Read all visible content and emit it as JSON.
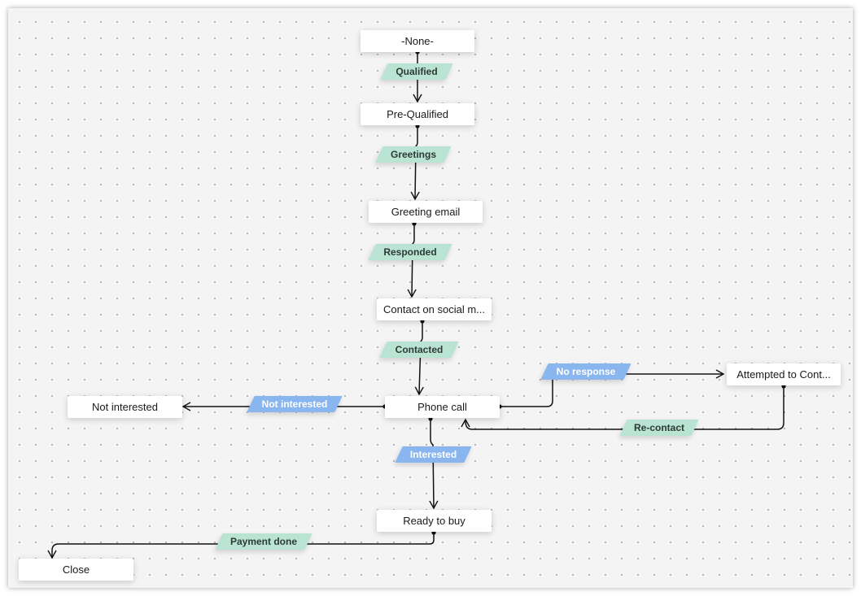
{
  "diagram": {
    "title": "",
    "colors": {
      "canvas": "#f4f4f4",
      "node": "#ffffff",
      "transition_green": "#b9e3d3",
      "transition_blue": "#8ab6f0",
      "edge": "#111111"
    },
    "nodes": [
      {
        "id": "none",
        "label": "-None-"
      },
      {
        "id": "prequalified",
        "label": "Pre-Qualified"
      },
      {
        "id": "greeting_email",
        "label": "Greeting email"
      },
      {
        "id": "contact_social",
        "label": "Contact on social m..."
      },
      {
        "id": "phone_call",
        "label": "Phone call"
      },
      {
        "id": "not_interested",
        "label": "Not interested"
      },
      {
        "id": "attempted",
        "label": "Attempted to Cont..."
      },
      {
        "id": "ready_to_buy",
        "label": "Ready to buy"
      },
      {
        "id": "close",
        "label": "Close"
      }
    ],
    "transitions": [
      {
        "id": "qualified",
        "label": "Qualified",
        "from": "none",
        "to": "prequalified",
        "style": "green"
      },
      {
        "id": "greetings",
        "label": "Greetings",
        "from": "prequalified",
        "to": "greeting_email",
        "style": "green"
      },
      {
        "id": "responded",
        "label": "Responded",
        "from": "greeting_email",
        "to": "contact_social",
        "style": "green"
      },
      {
        "id": "contacted",
        "label": "Contacted",
        "from": "contact_social",
        "to": "phone_call",
        "style": "green"
      },
      {
        "id": "not_interested_t",
        "label": "Not interested",
        "from": "phone_call",
        "to": "not_interested",
        "style": "blue"
      },
      {
        "id": "no_response",
        "label": "No response",
        "from": "phone_call",
        "to": "attempted",
        "style": "blue"
      },
      {
        "id": "re_contact",
        "label": "Re-contact",
        "from": "attempted",
        "to": "phone_call",
        "style": "green"
      },
      {
        "id": "interested",
        "label": "Interested",
        "from": "phone_call",
        "to": "ready_to_buy",
        "style": "blue"
      },
      {
        "id": "payment_done",
        "label": "Payment done",
        "from": "ready_to_buy",
        "to": "close",
        "style": "green"
      }
    ]
  }
}
